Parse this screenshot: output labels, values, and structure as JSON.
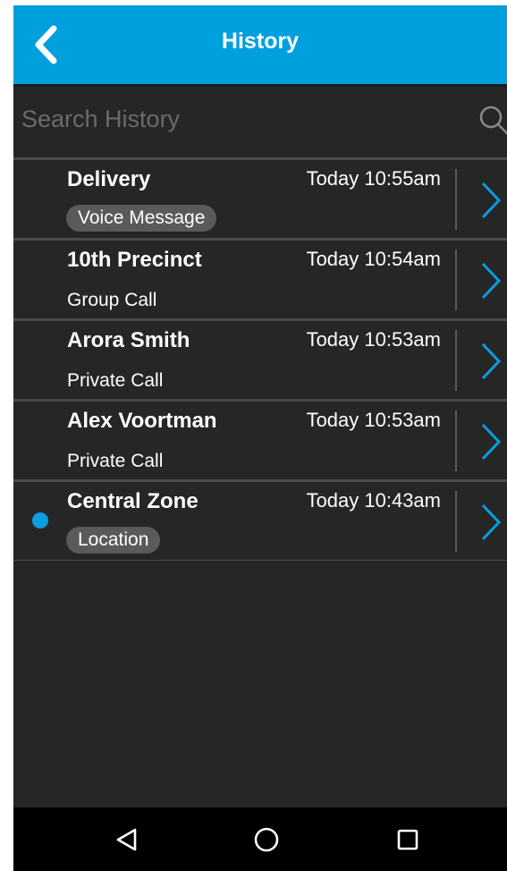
{
  "header": {
    "title": "History",
    "back_icon": "chevron-left-icon",
    "background": "#009fdd"
  },
  "search": {
    "placeholder": "Search History",
    "value": "",
    "icon": "search-icon"
  },
  "items": [
    {
      "title": "Delivery",
      "time": "Today 10:55am",
      "subtitle": "Voice Message",
      "subtitle_style": "pill",
      "unread": false
    },
    {
      "title": "10th Precinct",
      "time": "Today 10:54am",
      "subtitle": "Group Call",
      "subtitle_style": "plain",
      "unread": false
    },
    {
      "title": "Arora Smith",
      "time": "Today 10:53am",
      "subtitle": "Private Call",
      "subtitle_style": "plain",
      "unread": false
    },
    {
      "title": "Alex Voortman",
      "time": "Today 10:53am",
      "subtitle": "Private Call",
      "subtitle_style": "plain",
      "unread": false
    },
    {
      "title": "Central Zone",
      "time": "Today 10:43am",
      "subtitle": "Location",
      "subtitle_style": "pill",
      "unread": true
    }
  ],
  "navbar": {
    "buttons": [
      "back-triangle-icon",
      "home-circle-icon",
      "recents-square-icon"
    ]
  },
  "colors": {
    "accent": "#0a9de0",
    "background": "#262626",
    "divider": "#4a4a4a",
    "pill": "#5a5a5a"
  }
}
